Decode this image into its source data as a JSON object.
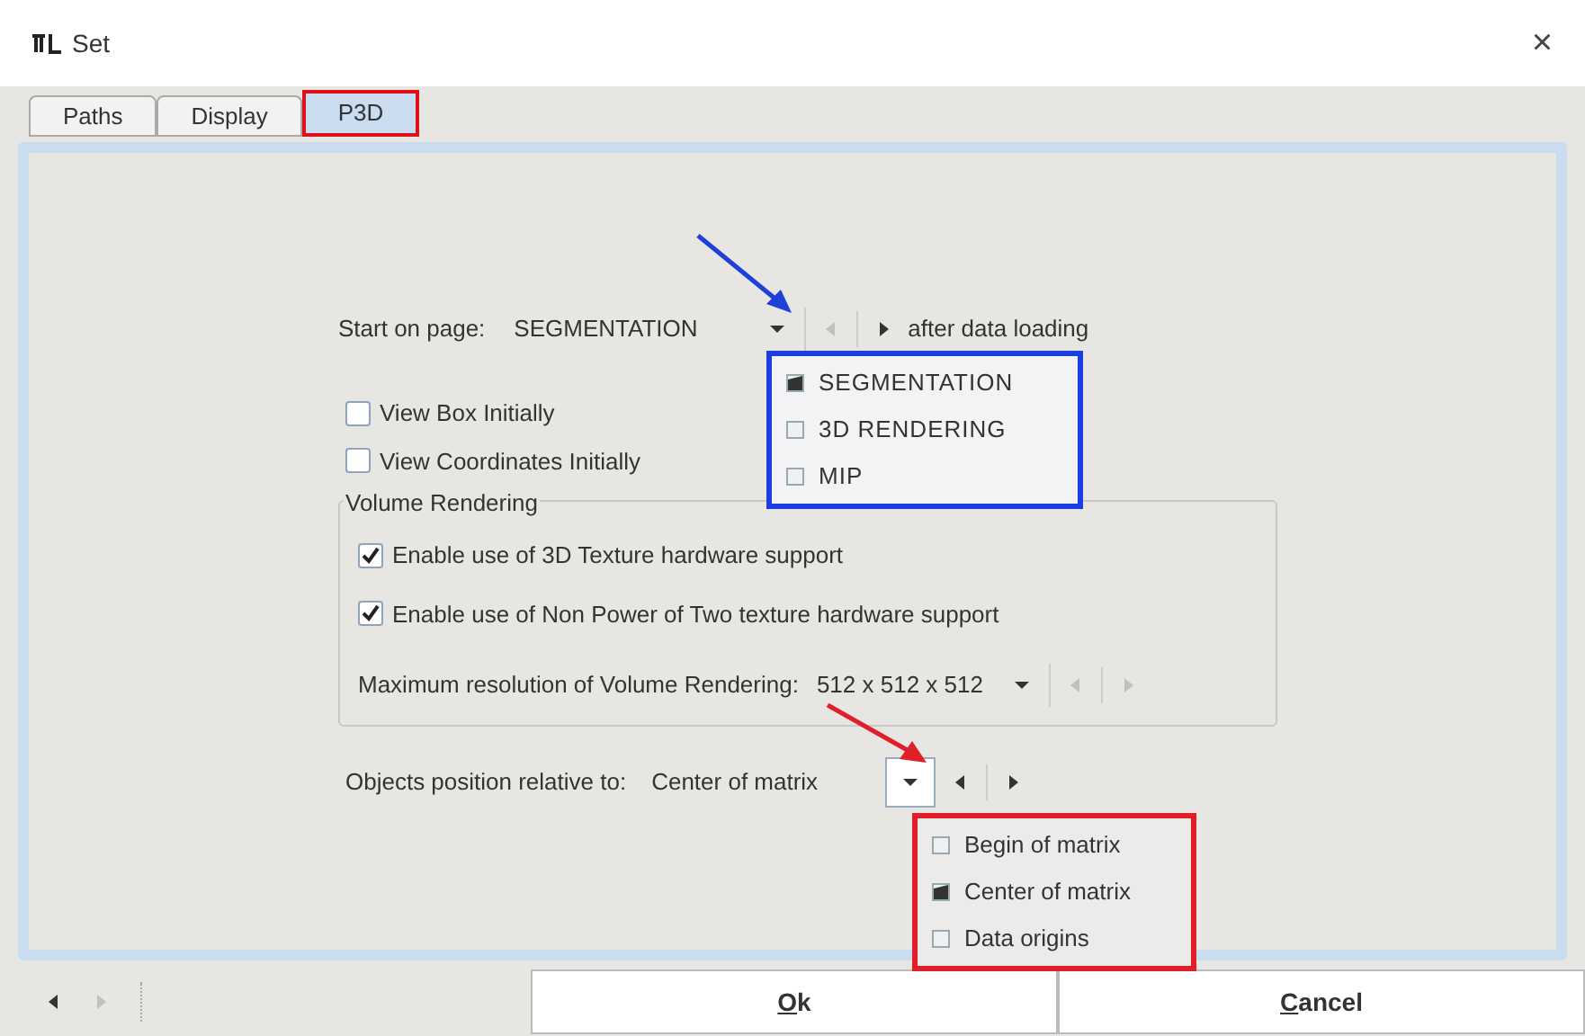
{
  "window": {
    "title": "Set",
    "close": "×"
  },
  "tabs": [
    {
      "label": "Paths",
      "selected": false
    },
    {
      "label": "Display",
      "selected": false
    },
    {
      "label": "P3D",
      "selected": true
    }
  ],
  "start_page": {
    "label": "Start on page:",
    "value": "SEGMENTATION",
    "suffix": "after data loading",
    "options": [
      {
        "label": "SEGMENTATION",
        "checked": true
      },
      {
        "label": "3D RENDERING",
        "checked": false
      },
      {
        "label": "MIP",
        "checked": false
      }
    ]
  },
  "checkboxes": [
    {
      "label": "View Box Initially",
      "checked": false
    },
    {
      "label": "View Coordinates Initially",
      "checked": false
    }
  ],
  "volume_rendering": {
    "title": "Volume Rendering",
    "options": [
      {
        "label": "Enable use of 3D Texture hardware support",
        "checked": true
      },
      {
        "label": "Enable use of Non Power of Two texture hardware support",
        "checked": true
      }
    ],
    "resolution": {
      "label": "Maximum resolution of Volume Rendering:",
      "value": "512 x 512 x 512"
    }
  },
  "objects_position": {
    "label": "Objects position relative to:",
    "value": "Center of matrix",
    "options": [
      {
        "label": "Begin of matrix",
        "checked": false
      },
      {
        "label": "Center of matrix",
        "checked": true
      },
      {
        "label": "Data origins",
        "checked": false
      }
    ]
  },
  "buttons": [
    "Ok",
    "Cancel"
  ]
}
